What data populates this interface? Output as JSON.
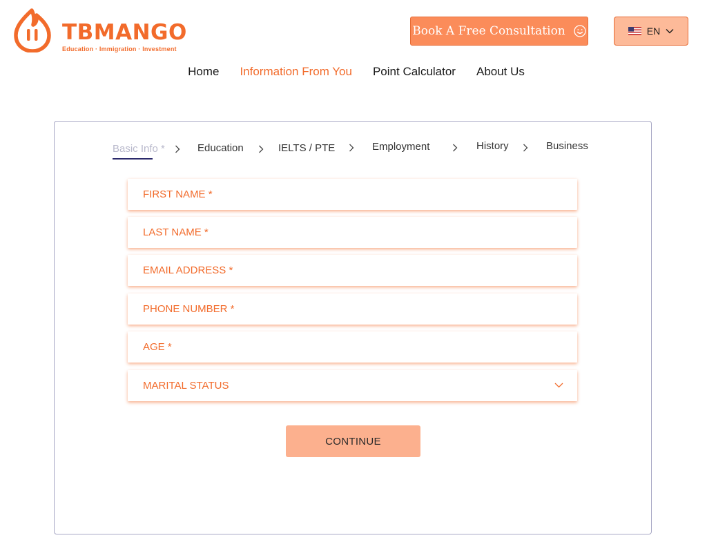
{
  "header": {
    "logo_name": "TBMANGO",
    "logo_tagline": "Education · Immigration · Investment",
    "book_button": "Book A Free Consultation",
    "language": "EN"
  },
  "nav": {
    "items": [
      "Home",
      "Information From You",
      "Point Calculator",
      "About Us"
    ],
    "active": "Information From You"
  },
  "steps": [
    "Basic Info *",
    "Education",
    "IELTS / PTE",
    "Employment",
    "History",
    "Business"
  ],
  "form": {
    "first_name_placeholder": "FIRST NAME *",
    "last_name_placeholder": "LAST NAME *",
    "email_placeholder": "EMAIL ADDRESS *",
    "phone_placeholder": "PHONE NUMBER *",
    "age_placeholder": "AGE *",
    "marital_status_label": "MARITAL STATUS",
    "continue_label": "CONTINUE"
  },
  "colors": {
    "brand": "#f26b2b",
    "button_fill": "#fb8c5a",
    "continue_fill": "#fcb08e",
    "step_underline": "#2b2a6b"
  },
  "icons": {
    "logo": "mango-flame-icon",
    "book": "smile-icon",
    "language": "us-flag-icon",
    "dropdown": "chevron-down-icon",
    "step_separator": "chevron-right-icon"
  }
}
